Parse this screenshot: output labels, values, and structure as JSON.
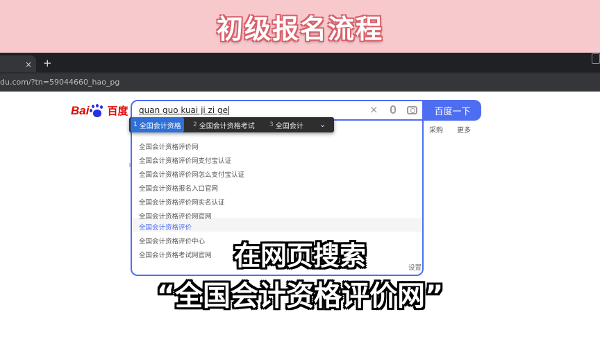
{
  "banner": {
    "title": "初级报名流程"
  },
  "browser": {
    "tab_close": "×",
    "new_tab": "+",
    "url": "du.com/?tn=59044660_hao_pg"
  },
  "baidu": {
    "logo_bai": "Bai",
    "logo_cn": "百度",
    "query": "quan guo kuai ji zi ge",
    "clear_icon": "×",
    "search_button": "百度一下",
    "nav_links": [
      "采购",
      "更多"
    ]
  },
  "ime": {
    "candidates": [
      {
        "num": "1",
        "text": "全国会计资格"
      },
      {
        "num": "2",
        "text": "全国会计资格考试"
      },
      {
        "num": "3",
        "text": "全国会计"
      }
    ],
    "expand_icon": "chevron-down-icon"
  },
  "suggestions": [
    "全国会计资格评价网",
    "全国会计资格评价网支付宝认证",
    "全国会计资格评价网怎么支付宝认证",
    "全国会计资格报名入口官网",
    "全国会计资格评价网实名认证",
    "全国会计资格评价网官网",
    "全国会计资格评价",
    "全国会计资格评价中心",
    "全国会计资格考试网官网"
  ],
  "settings_fragment": "设置",
  "captions": {
    "line1": "在网页搜索",
    "line2": "“全国会计资格评价网”"
  },
  "colors": {
    "accent": "#4e6ef2",
    "banner": "#f8c9cc",
    "baidu_red": "#e10602"
  }
}
